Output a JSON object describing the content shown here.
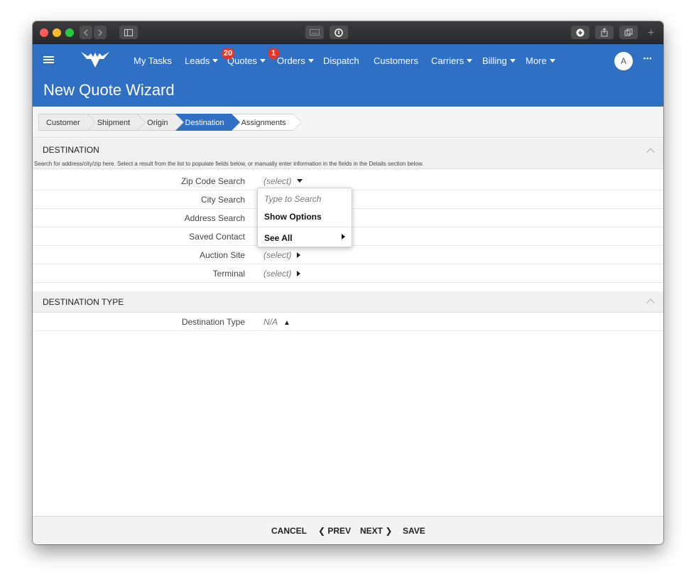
{
  "nav": {
    "my_tasks": "My Tasks",
    "leads": "Leads",
    "quotes": "Quotes",
    "quotes_badge": "20",
    "orders": "Orders",
    "orders_badge": "1",
    "dispatch": "Dispatch",
    "customers": "Customers",
    "carriers": "Carriers",
    "billing": "Billing",
    "more": "More",
    "avatar_initial": "A",
    "more_dots": "•••"
  },
  "page_title": "New Quote Wizard",
  "steps": [
    "Customer",
    "Shipment",
    "Origin",
    "Destination",
    "Assignments"
  ],
  "active_step": "Destination",
  "destination": {
    "title": "DESTINATION",
    "description": "Search for address/city/zip here. Select a result from the list to populate fields below, or manually enter information in the fields in the Details section below.",
    "rows": [
      {
        "label": "Zip Code Search",
        "value": "(select)"
      },
      {
        "label": "City Search",
        "value": ""
      },
      {
        "label": "Address Search",
        "value": ""
      },
      {
        "label": "Saved Contact",
        "value": ""
      },
      {
        "label": "Auction Site",
        "value": "(select)"
      },
      {
        "label": "Terminal",
        "value": "(select)"
      }
    ]
  },
  "dropdown": {
    "placeholder": "Type to Search",
    "show_options": "Show Options",
    "see_all": "See All"
  },
  "destination_type": {
    "title": "DESTINATION TYPE",
    "label": "Destination Type",
    "value": "N/A"
  },
  "footer": {
    "cancel": "CANCEL",
    "prev": "❮ PREV",
    "next": "NEXT ❯",
    "save": "SAVE"
  },
  "colors": {
    "header_blue": "#2f6fc4",
    "badge_red": "#e53528"
  }
}
